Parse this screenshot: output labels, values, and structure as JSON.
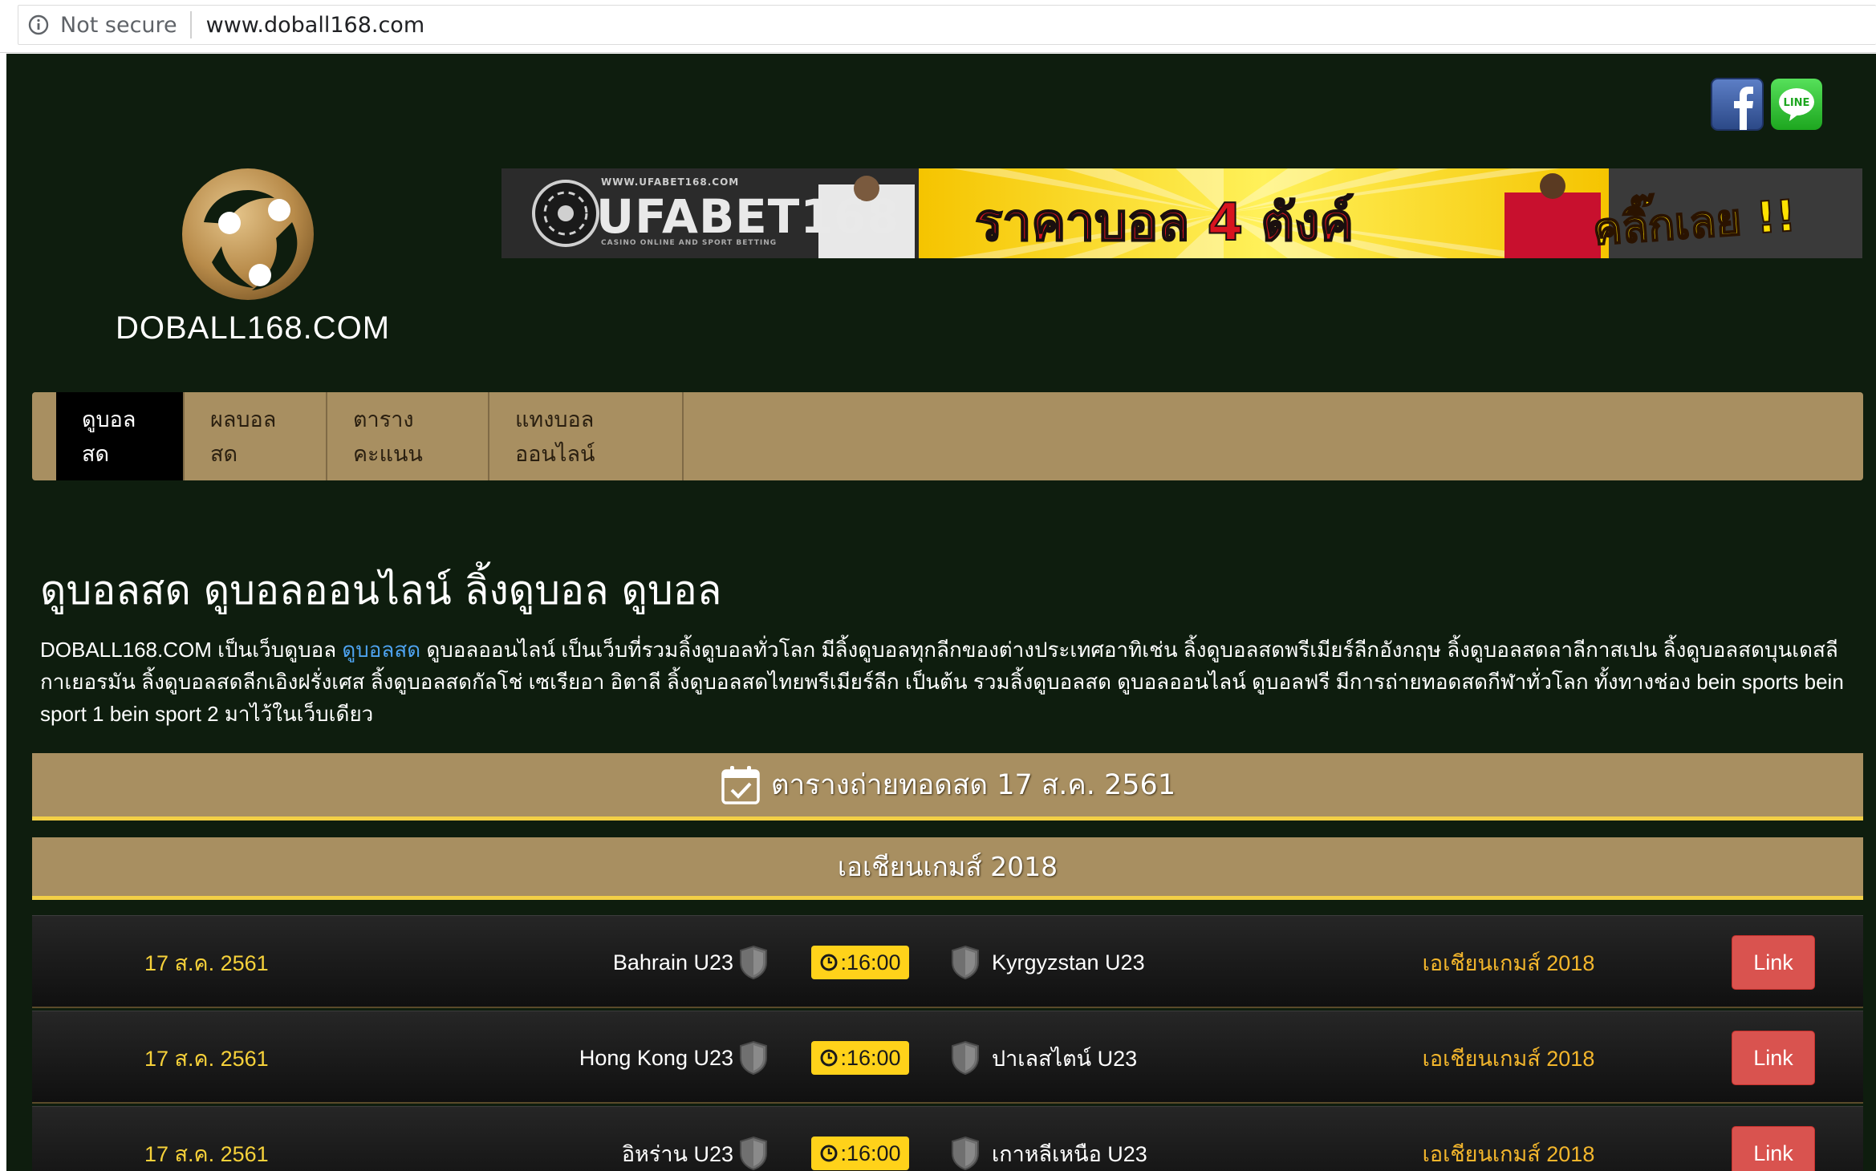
{
  "browser": {
    "security_label": "Not secure",
    "url": "www.doball168.com"
  },
  "social": {
    "facebook_icon": "facebook-icon",
    "line_icon": "line-icon",
    "line_label": "LINE"
  },
  "logo": {
    "text": "DOBALL168.COM"
  },
  "banner": {
    "brand": "UFABET168",
    "url": "WWW.UFABET168.COM",
    "tagline": "CASINO ONLINE AND SPORT BETTING",
    "headline": "ราคาบอล 4 ตังค์",
    "cta": "คลิ๊กเลย !!"
  },
  "nav": {
    "items": [
      {
        "label": "ดูบอลสด",
        "active": true
      },
      {
        "label": "ผลบอลสด",
        "active": false
      },
      {
        "label": "ตารางคะแนน",
        "active": false
      },
      {
        "label": "แทงบอลออนไลน์",
        "active": false
      }
    ]
  },
  "page": {
    "title": "ดูบอลสด ดูบอลออนไลน์ ลิ้งดูบอล ดูบอล",
    "intro_before_link": "DOBALL168.COM เป็นเว็บดูบอล ",
    "intro_link": "ดูบอลสด",
    "intro_after_link": " ดูบอลออนไลน์ เป็นเว็บที่รวมลิ้งดูบอลทั่วโลก มีลิ้งดูบอลทุกลีกของต่างประเทศอาทิเช่น ลิ้งดูบอลสดพรีเมียร์ลีกอังกฤษ ลิ้งดูบอลสดลาลีกาสเปน ลิ้งดูบอลสดบุนเดสลีกาเยอรมัน ลิ้งดูบอลสดลีกเอิงฝรั่งเศส ลิ้งดูบอลสดกัลโช่ เซเรียอา อิตาลี ลิ้งดูบอลสดไทยพรีเมียร์ลีก เป็นต้น รวมลิ้งดูบอลสด ดูบอลออนไลน์ ดูบอลฟรี มีการถ่ายทอดสดกีฬาทั่วโลก ทั้งทางช่อง bein sports bein sport 1 bein sport 2 มาไว้ในเว็บเดียว"
  },
  "schedule": {
    "title": "ตารางถ่ายทอดสด 17 ส.ค. 2561",
    "icon": "calendar-check-icon",
    "league_header": "เอเชียนเกมส์ 2018",
    "colors": {
      "gold_bar": "#a88f61",
      "accent_line": "#f2cf46",
      "date_text": "#f6d13a",
      "league_text": "#f3b62c",
      "link_button": "#d9534f"
    },
    "matches": [
      {
        "date": "17 ส.ค. 2561",
        "home": "Bahrain U23",
        "time": ":16:00",
        "away": "Kyrgyzstan U23",
        "league": "เอเชียนเกมส์ 2018",
        "link": "Link"
      },
      {
        "date": "17 ส.ค. 2561",
        "home": "Hong Kong U23",
        "time": ":16:00",
        "away": "ปาเลสไตน์ U23",
        "league": "เอเชียนเกมส์ 2018",
        "link": "Link"
      },
      {
        "date": "17 ส.ค. 2561",
        "home": "อิหร่าน U23",
        "time": ":16:00",
        "away": "เกาหลีเหนือ U23",
        "league": "เอเชียนเกมส์ 2018",
        "link": "Link"
      }
    ]
  }
}
